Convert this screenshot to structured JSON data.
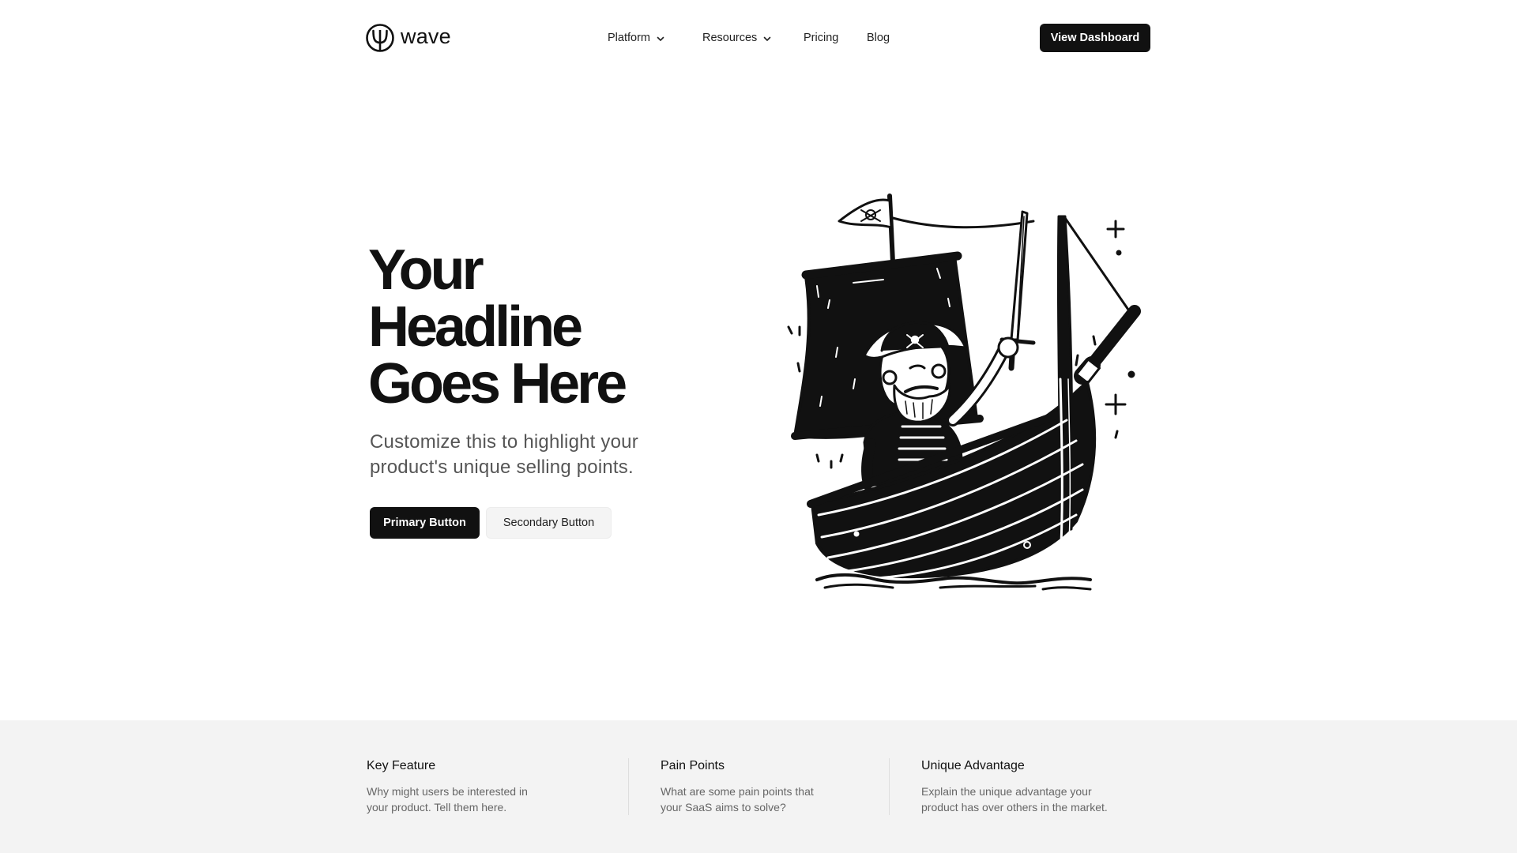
{
  "header": {
    "logo_text": "wave",
    "nav": [
      {
        "label": "Platform",
        "has_dropdown": true
      },
      {
        "label": "Resources",
        "has_dropdown": true
      },
      {
        "label": "Pricing",
        "has_dropdown": false
      },
      {
        "label": "Blog",
        "has_dropdown": false
      }
    ],
    "cta_label": "View Dashboard"
  },
  "hero": {
    "title_lines": [
      "Your",
      "Headline",
      "Goes Here"
    ],
    "subtitle": "Customize this to highlight your product's unique selling points.",
    "primary_button": "Primary Button",
    "secondary_button": "Secondary Button",
    "illustration": "pirate-ship-illustration"
  },
  "features": [
    {
      "title": "Key Feature",
      "description": "Why might users be interested in your product. Tell them here."
    },
    {
      "title": "Pain Points",
      "description": "What are some pain points that your SaaS aims to solve?"
    },
    {
      "title": "Unique Advantage",
      "description": "Explain the unique advantage your product has over others in the market."
    }
  ],
  "colors": {
    "primary": "#111111",
    "background": "#ffffff",
    "feature_band": "#f3f3f3",
    "muted_text": "#666666"
  }
}
